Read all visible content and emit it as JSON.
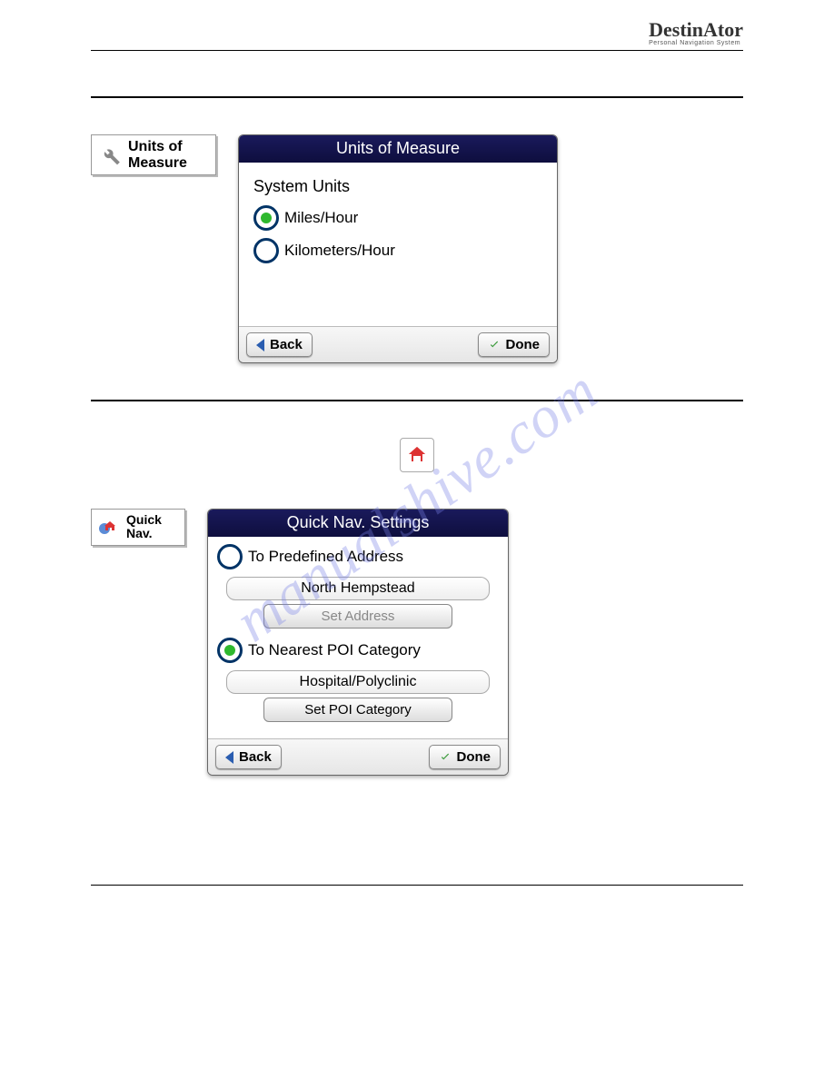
{
  "brand": {
    "name": "DestinAtor",
    "tagline": "Personal Navigation System"
  },
  "watermark": "manualshive.com",
  "section1": {
    "tile_label_line1": "Units of",
    "tile_label_line2": "Measure",
    "screen": {
      "title": "Units of Measure",
      "heading": "System Units",
      "options": [
        {
          "label": "Miles/Hour",
          "selected": true
        },
        {
          "label": "Kilometers/Hour",
          "selected": false
        }
      ],
      "back": "Back",
      "done": "Done"
    }
  },
  "midicon": {
    "name": "home-icon"
  },
  "section2": {
    "tile_label_line1": "Quick",
    "tile_label_line2": "Nav.",
    "screen": {
      "title": "Quick Nav. Settings",
      "opt1": {
        "label": "To Predefined Address",
        "selected": false
      },
      "field1": "North Hempstead",
      "btn1": "Set Address",
      "opt2": {
        "label": "To Nearest POI Category",
        "selected": true
      },
      "field2": "Hospital/Polyclinic",
      "btn2": "Set POI Category",
      "back": "Back",
      "done": "Done"
    }
  }
}
